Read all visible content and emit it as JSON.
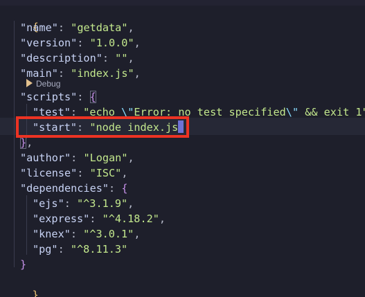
{
  "editor": {
    "open_brace": "{",
    "close_brace": "}",
    "codelens_debug": "Debug",
    "lines": {
      "name_key": "\"name\"",
      "name_val": "\"getdata\"",
      "version_key": "\"version\"",
      "version_val": "\"1.0.0\"",
      "description_key": "\"description\"",
      "description_val": "\"\"",
      "main_key": "\"main\"",
      "main_val": "\"index.js\"",
      "scripts_key": "\"scripts\"",
      "test_key": "\"test\"",
      "test_val_part1": "\"echo ",
      "test_val_esc1": "\\\"",
      "test_val_part2": "Error: no test specified",
      "test_val_esc2": "\\\"",
      "test_val_part3": " && exit 1\"",
      "start_key": "\"start\"",
      "start_val": "\"node index.js",
      "start_val_end": "\"",
      "author_key": "\"author\"",
      "author_val": "\"Logan\"",
      "license_key": "\"license\"",
      "license_val": "\"ISC\"",
      "dependencies_key": "\"dependencies\"",
      "ejs_key": "\"ejs\"",
      "ejs_val": "\"^3.1.9\"",
      "express_key": "\"express\"",
      "express_val": "\"^4.18.2\"",
      "knex_key": "\"knex\"",
      "knex_val": "\"^3.0.1\"",
      "pg_key": "\"pg\"",
      "pg_val": "\"^8.11.3\""
    }
  },
  "colors": {
    "background": "#1e1f2b",
    "key": "#c8d3f5",
    "string": "#c3e88d",
    "bracket_level1": "#f0c674",
    "bracket_level2": "#c792ea",
    "highlight_border": "#ec3323",
    "cursor": "#6f72d6"
  }
}
